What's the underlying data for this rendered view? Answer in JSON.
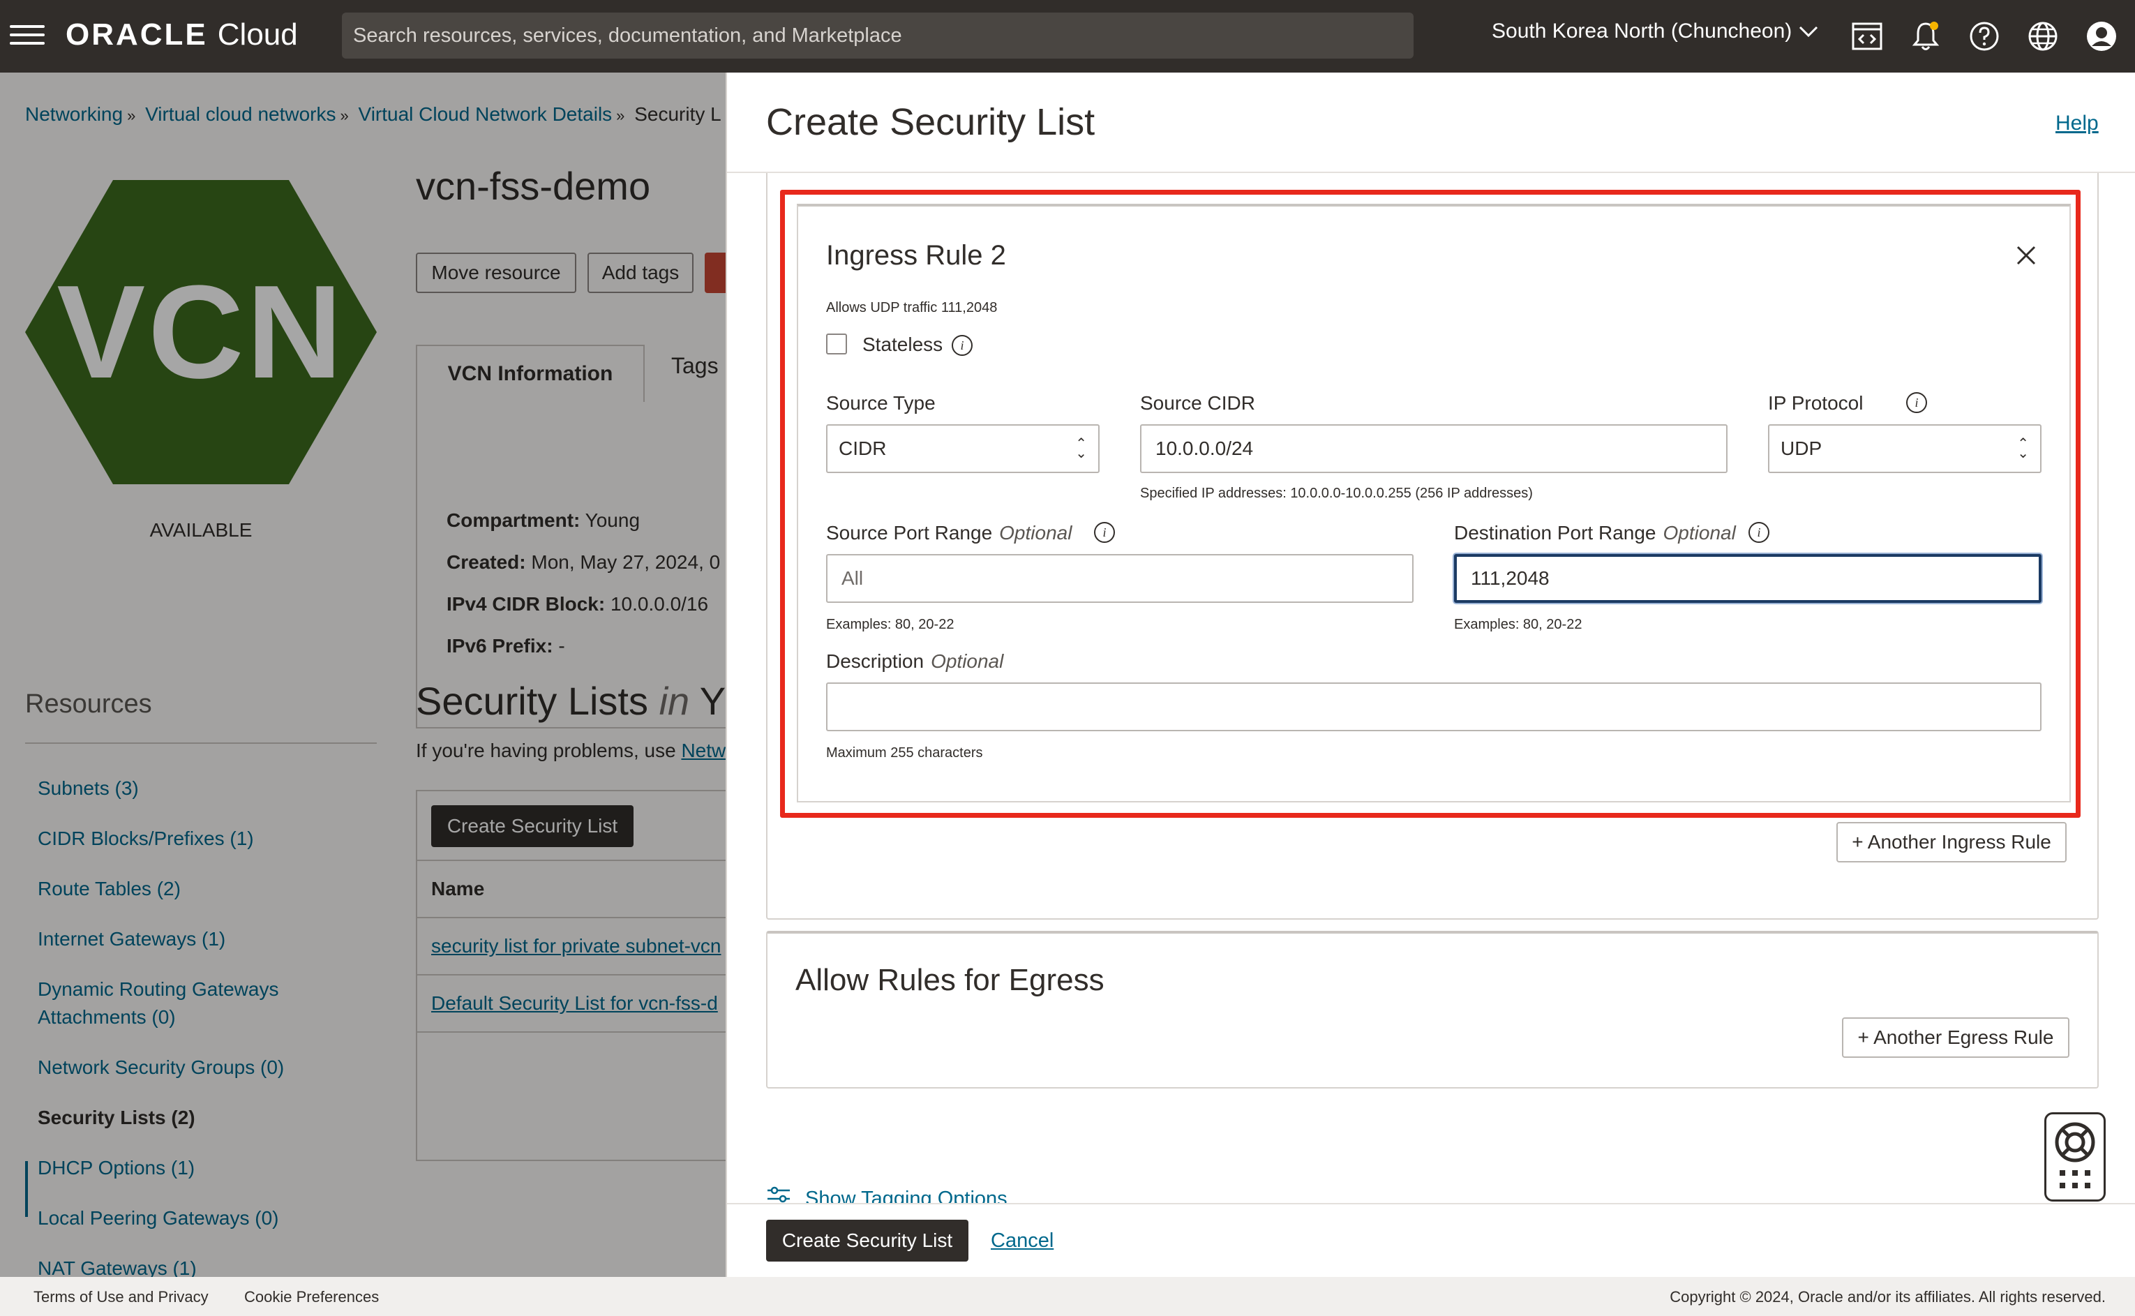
{
  "topbar": {
    "brand": "ORACLE",
    "brand_product": "Cloud",
    "search_placeholder": "Search resources, services, documentation, and Marketplace",
    "region": "South Korea North (Chuncheon)",
    "icons": [
      "menu-icon",
      "code-editor-icon",
      "notification-bell-icon",
      "help-icon",
      "language-globe-icon",
      "user-profile-icon"
    ]
  },
  "background": {
    "breadcrumb": [
      "Networking",
      "Virtual cloud networks",
      "Virtual Cloud Network Details",
      "Security L"
    ],
    "badge_text": "VCN",
    "status": "AVAILABLE",
    "title": "vcn-fss-demo",
    "buttons": {
      "move": "Move resource",
      "tags": "Add tags"
    },
    "tabs": [
      "VCN Information",
      "Tags"
    ],
    "info": [
      {
        "label": "Compartment:",
        "value": "Young"
      },
      {
        "label": "Created:",
        "value": "Mon, May 27, 2024, 0"
      },
      {
        "label": "IPv4 CIDR Block:",
        "value": "10.0.0.0/16"
      },
      {
        "label": "IPv6 Prefix:",
        "value": "-"
      }
    ],
    "security_heading": "Security Lists",
    "security_heading_in": "in",
    "security_heading_tail": "Y",
    "problems_text": "If you're having problems, use",
    "problems_link": "Netw",
    "create_button": "Create Security List",
    "table_header": "Name",
    "table_rows": [
      "security list for private subnet-vcn",
      "Default Security List for vcn-fss-d"
    ],
    "resources_title": "Resources",
    "resources": [
      "Subnets (3)",
      "CIDR Blocks/Prefixes (1)",
      "Route Tables (2)",
      "Internet Gateways (1)",
      "Dynamic Routing Gateways Attachments (0)",
      "Network Security Groups (0)",
      "Security Lists (2)",
      "DHCP Options (1)",
      "Local Peering Gateways (0)",
      "NAT Gateways (1)"
    ]
  },
  "panel": {
    "title": "Create Security List",
    "help": "Help",
    "rule": {
      "title": "Ingress Rule 2",
      "description": "Allows UDP traffic 111,2048",
      "stateless_label": "Stateless",
      "stateless_checked": false,
      "source_type_label": "Source Type",
      "source_type_value": "CIDR",
      "source_cidr_label": "Source CIDR",
      "source_cidr_value": "10.0.0.0/24",
      "source_cidr_help": "Specified IP addresses: 10.0.0.0-10.0.0.255 (256 IP addresses)",
      "ip_protocol_label": "IP Protocol",
      "ip_protocol_value": "UDP",
      "source_port_label": "Source Port Range",
      "source_port_placeholder": "All",
      "source_port_help": "Examples: 80, 20-22",
      "dest_port_label": "Destination Port Range",
      "dest_port_value": "111,2048",
      "dest_port_help": "Examples: 80, 20-22",
      "optional": "Optional",
      "description_label": "Description",
      "description_value": "",
      "description_help": "Maximum 255 characters"
    },
    "another_ingress": "+ Another Ingress Rule",
    "egress_title": "Allow Rules for Egress",
    "another_egress": "+ Another Egress Rule",
    "tagging_link": "Show Tagging Options",
    "submit": "Create Security List",
    "cancel": "Cancel",
    "highlight_color": "#e8291c"
  },
  "footer": {
    "terms": "Terms of Use and Privacy",
    "cookies": "Cookie Preferences",
    "copyright": "Copyright © 2024, Oracle and/or its affiliates. All rights reserved."
  }
}
